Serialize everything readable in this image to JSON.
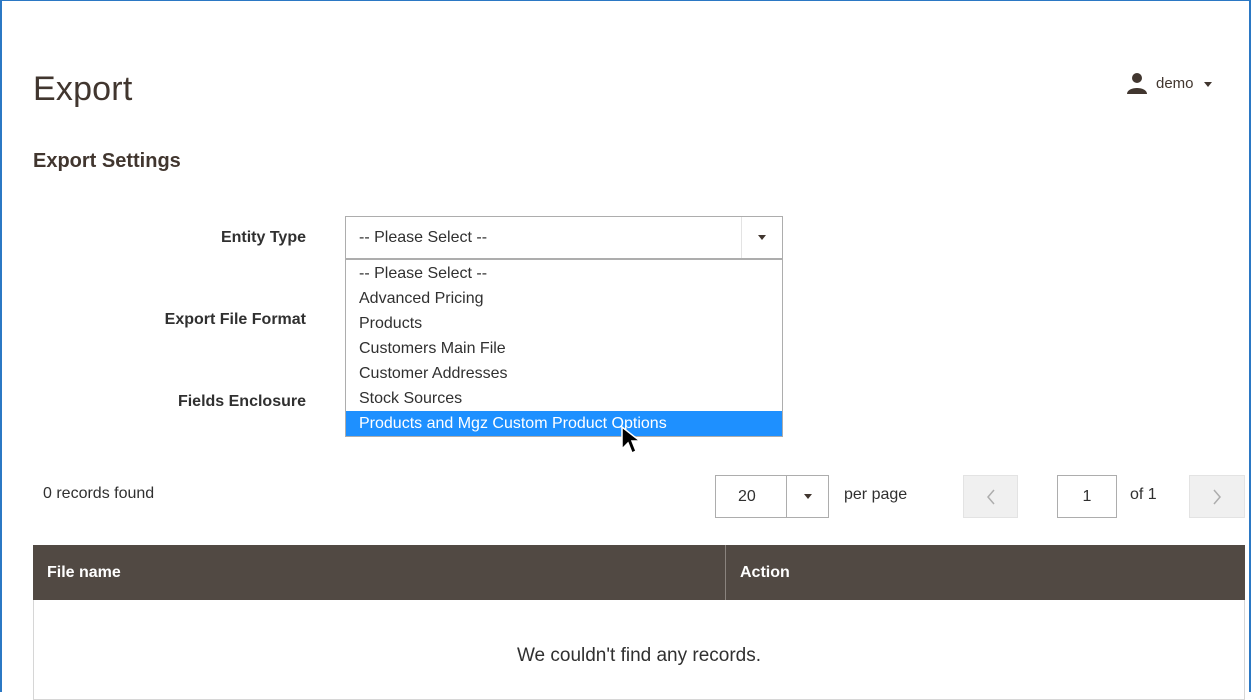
{
  "header": {
    "title": "Export",
    "user_name": "demo"
  },
  "settings": {
    "section_title": "Export Settings",
    "entity_type_label": "Entity Type",
    "export_file_format_label": "Export File Format",
    "fields_enclosure_label": "Fields Enclosure",
    "entity_select": {
      "value": "-- Please Select --",
      "options": [
        "-- Please Select --",
        "Advanced Pricing",
        "Products",
        "Customers Main File",
        "Customer Addresses",
        "Stock Sources",
        "Products and Mgz Custom Product Options"
      ],
      "highlighted": "Products and Mgz Custom Product Options"
    }
  },
  "grid": {
    "records_found": "0 records found",
    "per_page_value": "20",
    "per_page_label": "per page",
    "current_page": "1",
    "page_total": "of 1",
    "columns": [
      "File name",
      "Action"
    ],
    "empty_message": "We couldn't find any records."
  },
  "colors": {
    "header_bg": "#514943",
    "highlight": "#1e90ff",
    "frame_border": "#2b78c4"
  }
}
